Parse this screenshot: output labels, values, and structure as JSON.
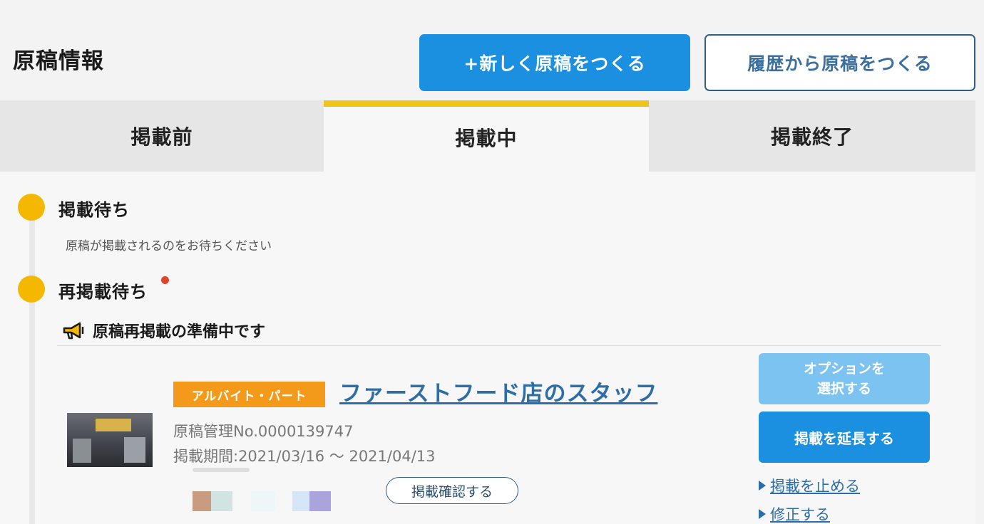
{
  "header": {
    "title": "原稿情報",
    "new_button": "+新しく原稿をつくる",
    "history_button": "履歴から原稿をつくる"
  },
  "tabs": [
    {
      "label": "掲載前",
      "active": false
    },
    {
      "label": "掲載中",
      "active": true
    },
    {
      "label": "掲載終了",
      "active": false
    }
  ],
  "statuses": [
    {
      "title": "掲載待ち",
      "description": "原稿が掲載されるのをお待ちください"
    },
    {
      "title": "再掲載待ち",
      "has_alert": true
    }
  ],
  "notice": {
    "icon": "megaphone-icon",
    "text": "原稿再掲載の準備中です"
  },
  "listing": {
    "badge": "アルバイト・パート",
    "title": "ファーストフード店のスタッフ",
    "manage_no": "原稿管理No.0000139747",
    "period": "掲載期間:2021/03/16 〜 2021/04/13",
    "confirm_button": "掲載確認する",
    "option_button": "オプションを\n選択する",
    "extend_button": "掲載を延長する",
    "links": [
      "掲載を止める",
      "修正する"
    ]
  },
  "colors": {
    "accent_blue": "#1b8fe0",
    "light_blue": "#7cc3f1",
    "tab_indicator": "#f0c419",
    "status_dot": "#f5b800",
    "badge_orange": "#f39a1a",
    "alert_red": "#e0452b"
  }
}
